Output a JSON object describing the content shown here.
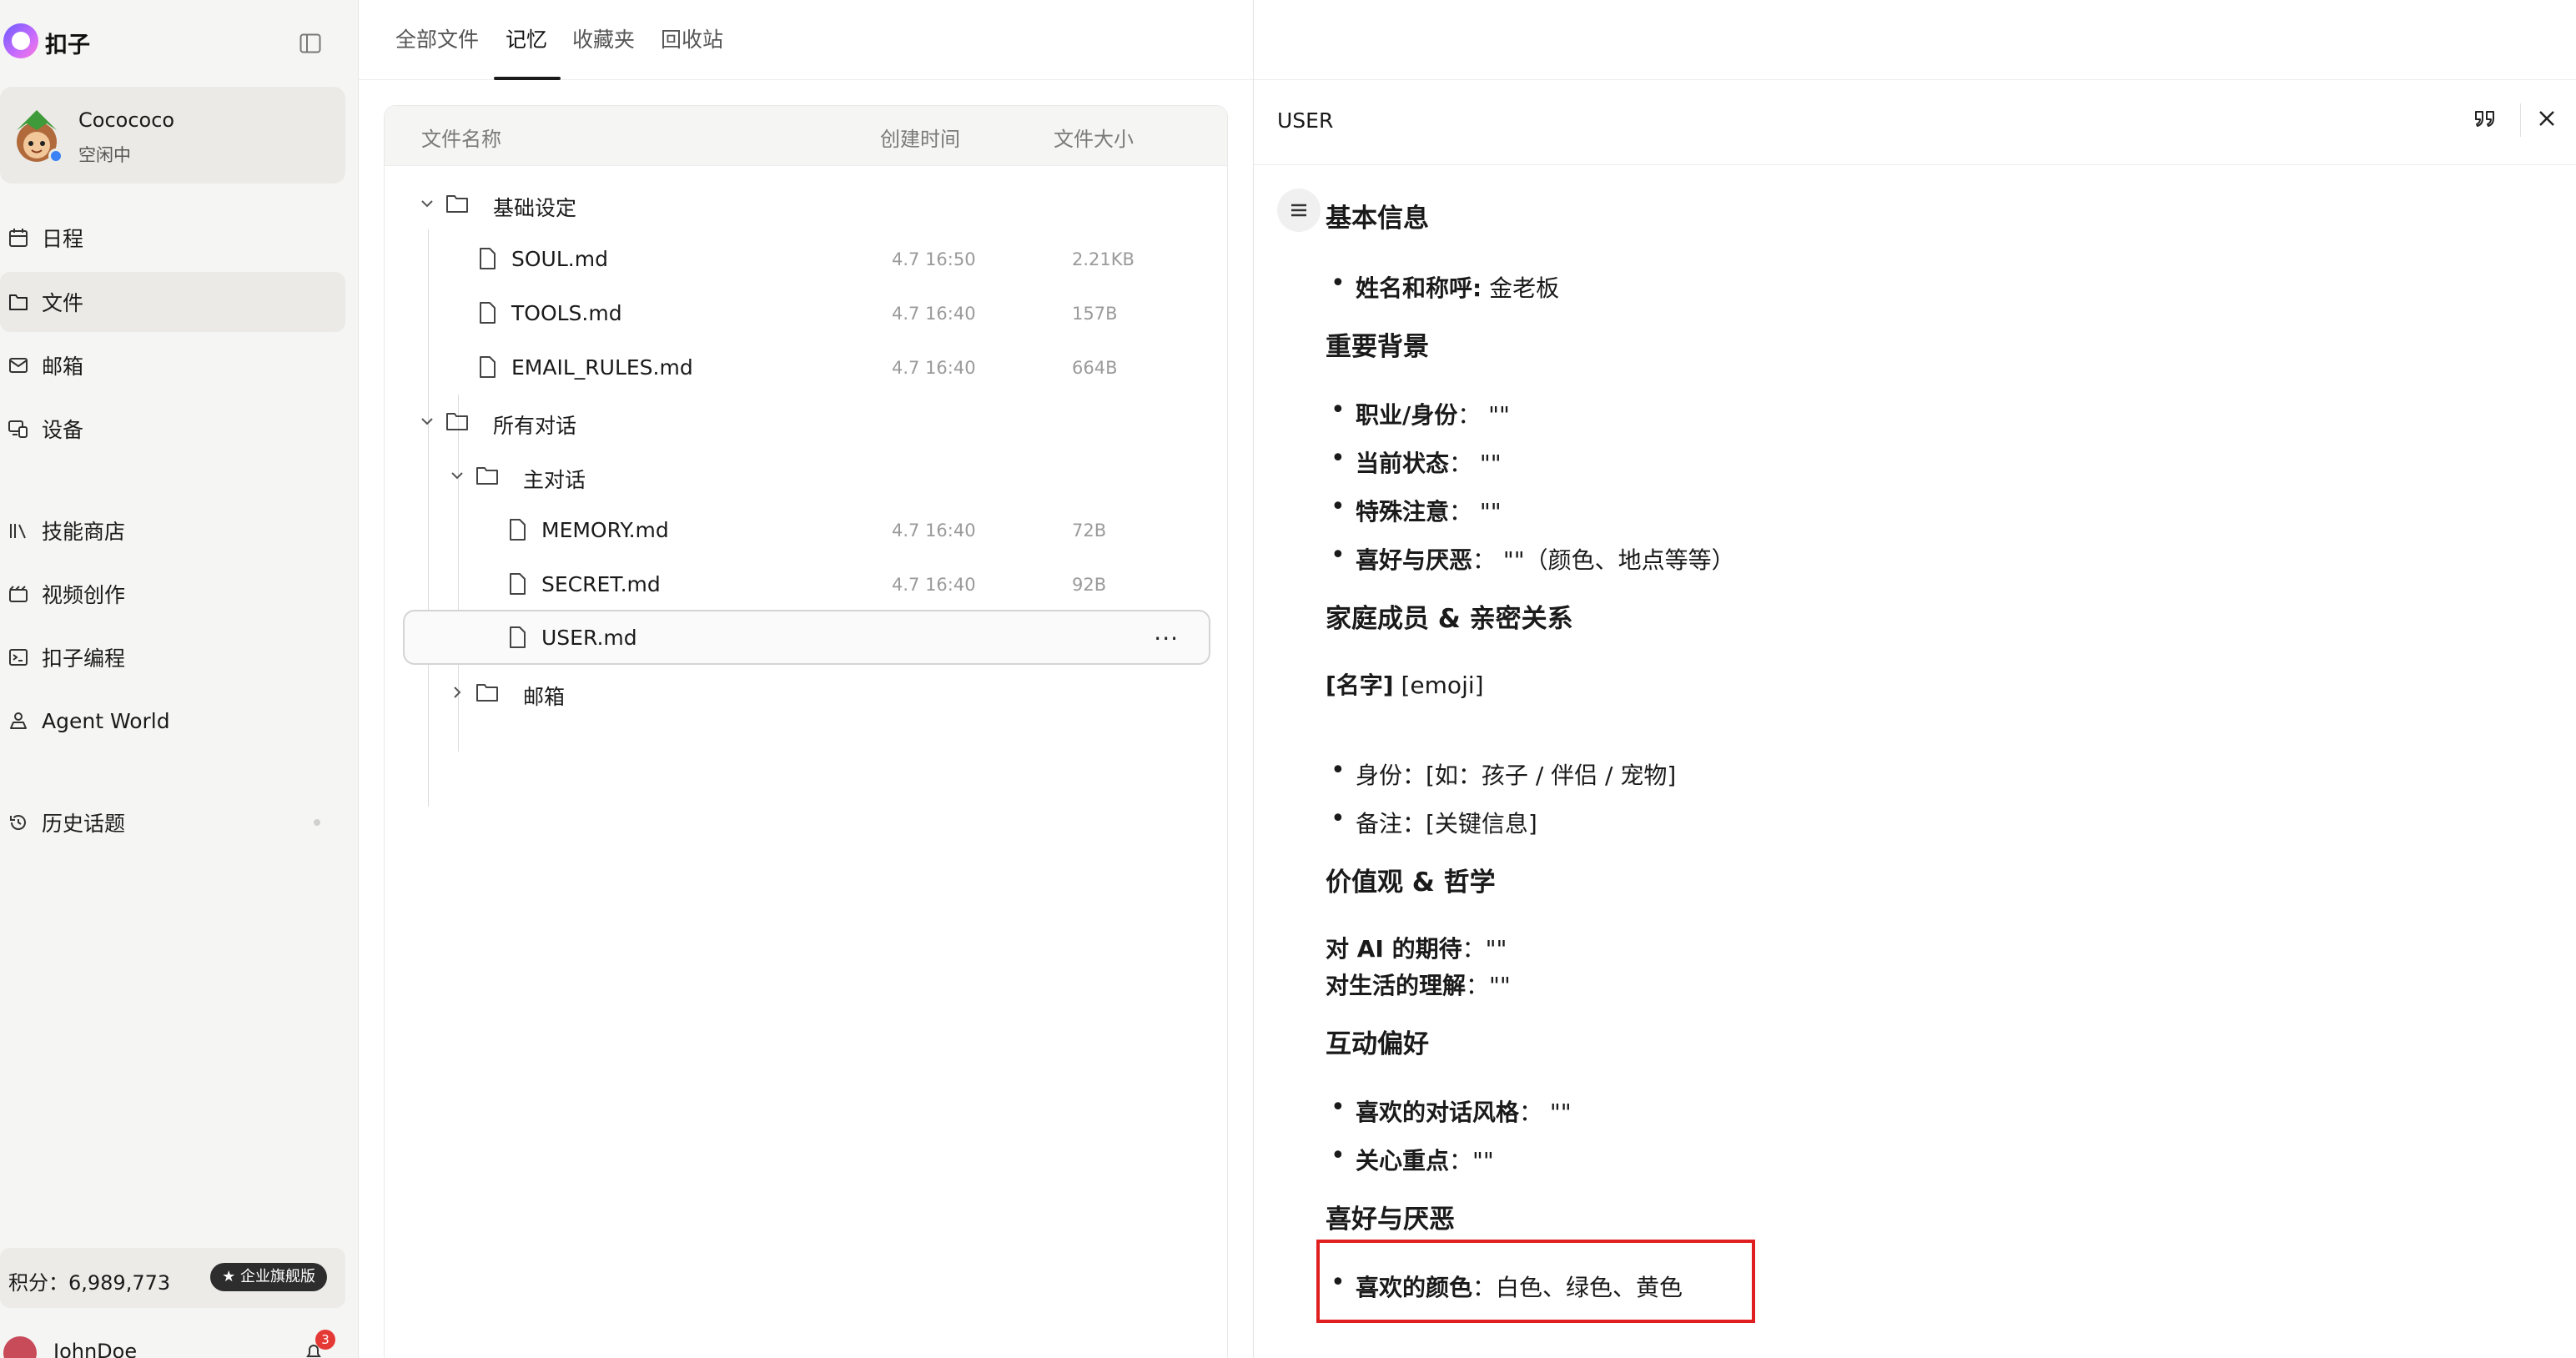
{
  "app": {
    "name": "扣子"
  },
  "profile": {
    "name": "Cocococo",
    "status": "空闲中"
  },
  "nav": [
    {
      "label": "日程",
      "icon": "calendar-icon"
    },
    {
      "label": "文件",
      "icon": "folder-icon",
      "active": true
    },
    {
      "label": "邮箱",
      "icon": "mail-icon"
    },
    {
      "label": "设备",
      "icon": "devices-icon"
    },
    {
      "label": "技能商店",
      "icon": "library-icon"
    },
    {
      "label": "视频创作",
      "icon": "video-icon"
    },
    {
      "label": "扣子编程",
      "icon": "terminal-icon"
    },
    {
      "label": "Agent World",
      "icon": "agent-icon"
    },
    {
      "label": "历史话题",
      "icon": "history-icon"
    }
  ],
  "points": {
    "label": "积分：6,989,773",
    "badge": "★ 企业旗舰版"
  },
  "user": {
    "name": "JohnDoe",
    "notifications": "3"
  },
  "tabs": [
    "全部文件",
    "记忆",
    "收藏夹",
    "回收站"
  ],
  "active_tab": "记忆",
  "file_list": {
    "columns": {
      "name": "文件名称",
      "created": "创建时间",
      "size": "文件大小"
    },
    "rows": [
      {
        "type": "folder",
        "name": "基础设定",
        "expanded": true,
        "time": "",
        "size": ""
      },
      {
        "type": "file",
        "name": "SOUL.md",
        "time": "4.7 16:50",
        "size": "2.21KB"
      },
      {
        "type": "file",
        "name": "TOOLS.md",
        "time": "4.7 16:40",
        "size": "157B"
      },
      {
        "type": "file",
        "name": "EMAIL_RULES.md",
        "time": "4.7 16:40",
        "size": "664B"
      },
      {
        "type": "folder",
        "name": "所有对话",
        "expanded": true,
        "time": "",
        "size": ""
      },
      {
        "type": "folder",
        "name": "主对话",
        "expanded": true,
        "time": "",
        "size": ""
      },
      {
        "type": "file",
        "name": "MEMORY.md",
        "time": "4.7 16:40",
        "size": "72B"
      },
      {
        "type": "file",
        "name": "SECRET.md",
        "time": "4.7 16:40",
        "size": "92B"
      },
      {
        "type": "file",
        "name": "USER.md",
        "time": "",
        "size": "",
        "selected": true,
        "more": "···"
      },
      {
        "type": "folder",
        "name": "邮箱",
        "expanded": false,
        "time": "",
        "size": ""
      }
    ]
  },
  "preview": {
    "title": "USER",
    "content": {
      "h_basic": "基本信息",
      "basic_name_key": "姓名和称呼:",
      "basic_name_val": " 金老板",
      "h_background": "重要背景",
      "bg_job_key": "职业/身份",
      "bg_job_val": "：  \"\"",
      "bg_state_key": "当前状态",
      "bg_state_val": "：  \"\"",
      "bg_note_key": "特殊注意",
      "bg_note_val": "：  \"\"",
      "bg_like_key": "喜好与厌恶",
      "bg_like_val": "：  \"\"（颜色、地点等等）",
      "h_family": "家庭成员 & 亲密关系",
      "family_name_key": "[名字]",
      "family_name_val": " [emoji]",
      "family_role": "身份：[如：孩子 / 伴侣 / 宠物]",
      "family_memo": "备注：[关键信息]",
      "h_values": "价值观 & 哲学",
      "values_ai_key": "对 AI 的期待",
      "values_ai_val": "：\"\"",
      "values_life_key": "对生活的理解",
      "values_life_val": "：\"\"",
      "h_interact": "互动偏好",
      "interact_style_key": "喜欢的对话风格",
      "interact_style_val": "：  \"\"",
      "interact_focus_key": "关心重点",
      "interact_focus_val": "：\"\"",
      "h_likes": "喜好与厌恶",
      "likes_color_key": "喜欢的颜色",
      "likes_color_val": "：白色、绿色、黄色"
    }
  },
  "colors": {
    "highlight": "#e02020",
    "sidebar_bg": "#f5f5f4",
    "status_online": "#3b82f6",
    "badge_bg": "#2d2d2d",
    "notification": "#e53935"
  }
}
